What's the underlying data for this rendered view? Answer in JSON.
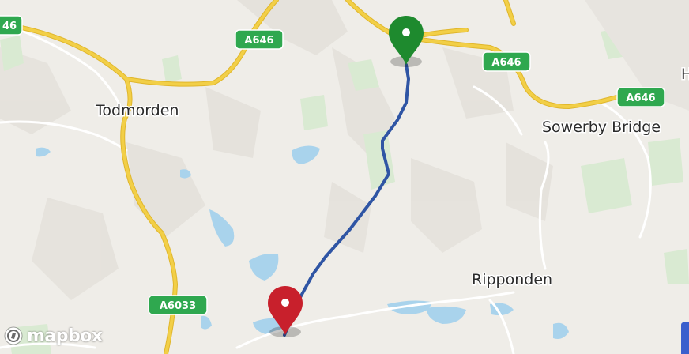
{
  "map": {
    "places": [
      {
        "name": "Todmorden"
      },
      {
        "name": "Sowerby Bridge"
      },
      {
        "name": "Ripponden"
      },
      {
        "name": "H"
      }
    ],
    "road_shields": [
      {
        "label": "A646"
      },
      {
        "label": "A646"
      },
      {
        "label": "A646"
      },
      {
        "label": "A6033"
      },
      {
        "label": "46"
      }
    ],
    "markers": [
      {
        "role": "start",
        "color": "#1e8a2e",
        "icon": "map-pin-icon"
      },
      {
        "role": "end",
        "color": "#c8202c",
        "icon": "map-pin-icon"
      }
    ],
    "route": {
      "color": "#2f55a4"
    },
    "attribution": {
      "logo_text": "mapbox",
      "logo_icon": "mapbox-logo-icon"
    },
    "colors": {
      "land": "#efede8",
      "water": "#a9d3ec",
      "park": "#d9ead2",
      "road_primary": "#f2cf47",
      "road_minor": "#ffffff"
    }
  }
}
